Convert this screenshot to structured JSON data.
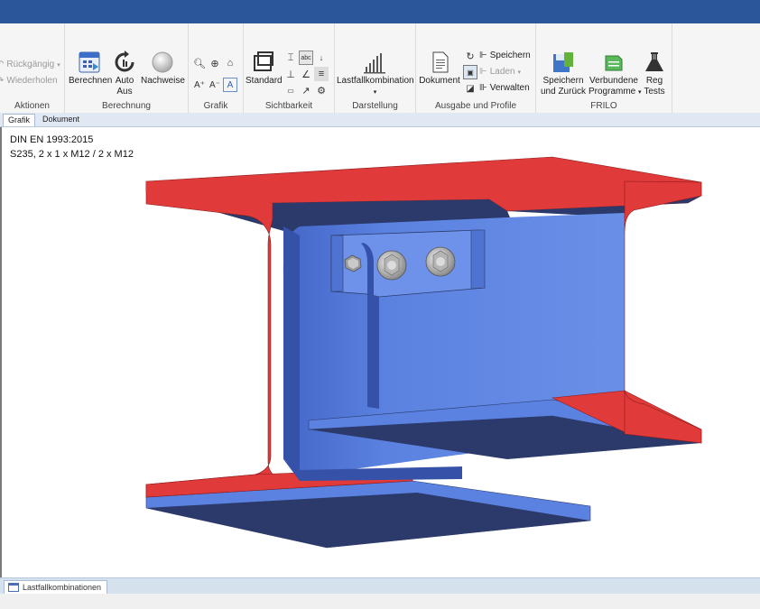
{
  "ribbon": {
    "aktionen": {
      "label": "Aktionen",
      "undo": "Rückgängig",
      "redo": "Wiederholen"
    },
    "berechnung": {
      "label": "Berechnung",
      "berechnen": "Berechnen",
      "auto_line1": "Auto",
      "auto_line2": "Aus",
      "nachweise": "Nachweise"
    },
    "grafik": {
      "label": "Grafik"
    },
    "sichtbarkeit": {
      "label": "Sichtbarkeit",
      "standard": "Standard"
    },
    "darstellung": {
      "label": "Darstellung",
      "lastfall": "Lastfallkombination"
    },
    "ausgabe": {
      "label": "Ausgabe und Profile",
      "dokument": "Dokument",
      "speichern": "Speichern",
      "laden": "Laden",
      "verwalten": "Verwalten"
    },
    "frilo": {
      "label": "FRILO",
      "speichern_line1": "Speichern",
      "speichern_line2": "und Zurück",
      "verbundene_line1": "Verbundene",
      "verbundene_line2": "Programme",
      "reg_line1": "Reg",
      "reg_line2": "Tests"
    }
  },
  "tabs": [
    "Grafik",
    "Dokument"
  ],
  "canvas": {
    "line1": "DIN EN 1993:2015",
    "line2": "S235, 2 x 1 x M12 / 2 x M12"
  },
  "bottom_tab": "Lastfallkombinationen",
  "colors": {
    "titlebar": "#2b579a",
    "steel_face": "#5b82e0",
    "steel_dark": "#2c3a6b",
    "cut_face": "#e03a3a"
  }
}
